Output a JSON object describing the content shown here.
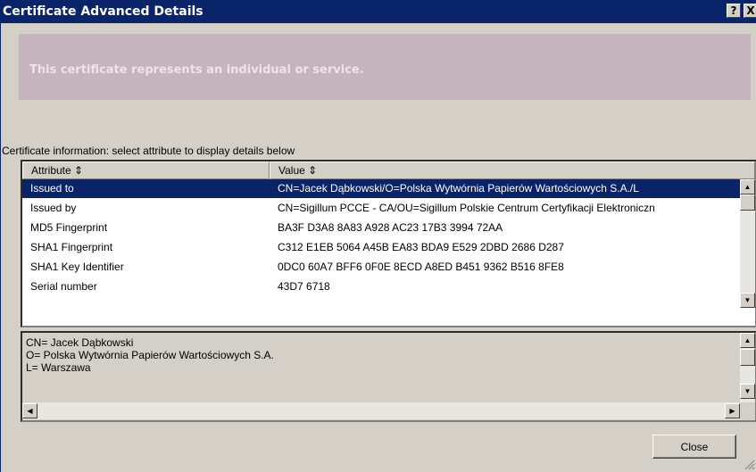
{
  "window": {
    "title": "Certificate Advanced Details",
    "help_icon": "?",
    "close_icon": "X"
  },
  "banner": {
    "text": "This certificate represents an individual or service."
  },
  "info_label": "Certificate information:  select attribute to display details below",
  "table": {
    "columns": [
      "Attribute",
      "Value"
    ],
    "rows": [
      {
        "attribute": "Issued to",
        "value": "CN=Jacek Dąbkowski/O=Polska Wytwórnia Papierów Wartościowych S.A./L",
        "selected": true
      },
      {
        "attribute": "Issued by",
        "value": "CN=Sigillum PCCE - CA/OU=Sigillum Polskie Centrum Certyfikacji Elektroniczn"
      },
      {
        "attribute": "MD5 Fingerprint",
        "value": "BA3F D3A8 8A83 A928 AC23 17B3 3994 72AA"
      },
      {
        "attribute": "SHA1 Fingerprint",
        "value": "C312 E1EB 5064 A45B EA83 BDA9 E529 2DBD 2686 D287"
      },
      {
        "attribute": "SHA1 Key Identifier",
        "value": "0DC0 60A7 BFF6 0F0E 8ECD A8ED B451 9362 B516 8FE8"
      },
      {
        "attribute": "Serial number",
        "value": "43D7 6718"
      }
    ]
  },
  "details": {
    "lines": [
      "CN= Jacek Dąbkowski",
      "O= Polska Wytwórnia Papierów Wartościowych S.A.",
      "L= Warszawa"
    ]
  },
  "buttons": {
    "close": "Close"
  },
  "colors": {
    "title_bar": "#0a246a",
    "banner": "#c5b3bd",
    "selection": "#0a246a",
    "face": "#d4d0c8"
  }
}
